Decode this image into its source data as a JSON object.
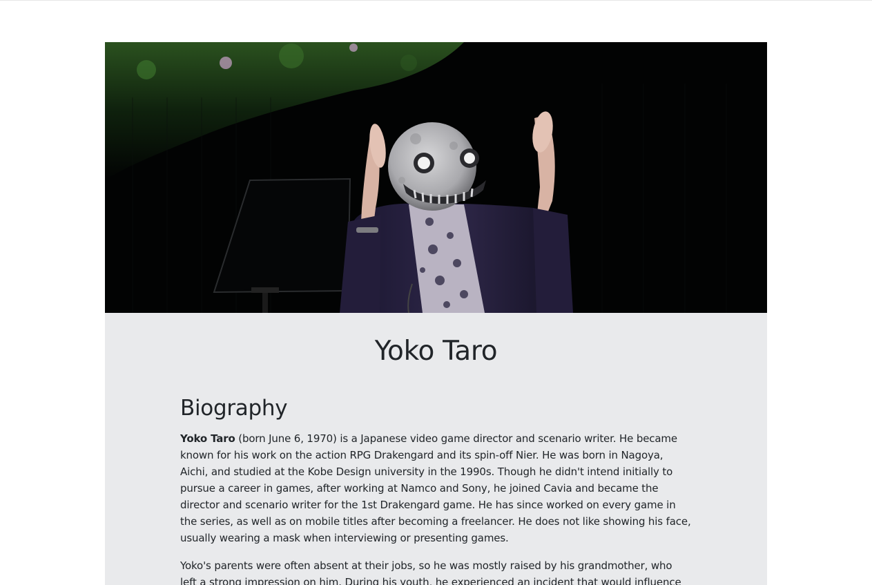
{
  "hero": {
    "image_alt": "Yoko Taro wearing moon mask on stage"
  },
  "profile": {
    "name": "Yoko Taro"
  },
  "biography": {
    "heading": "Biography",
    "p1_bold": "Yoko Taro",
    "p1_rest": " (born June 6, 1970) is a Japanese video game director and scenario writer. He became known for his work on the action RPG Drakengard and its spin-off Nier. He was born in Nagoya, Aichi, and studied at the Kobe Design university in the 1990s. Though he didn't intend initially to pursue a career in games, after working at Namco and Sony, he joined Cavia and became the director and scenario writer for the 1st Drakengard game. He has since worked on every game in the series, as well as on mobile titles after becoming a freelancer. He does not like showing his face, usually wearing a mask when interviewing or presenting games.",
    "p2": "Yoko's parents were often absent at their jobs, so he was mostly raised by his grandmother, who left a strong impression on him. During his youth, he experienced an incident that would influence his later"
  },
  "colors": {
    "card_bg": "#e9eaec",
    "hero_bg": "#020303",
    "text": "#212529"
  }
}
